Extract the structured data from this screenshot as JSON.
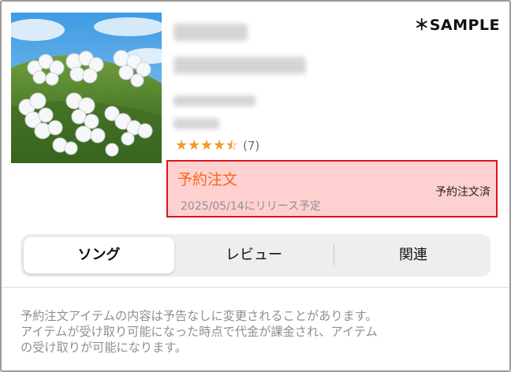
{
  "watermark": "＊SAMPLE",
  "rating": {
    "value": 4.5,
    "max": 5,
    "count_text": "(7)",
    "star_color": "#f09a2a"
  },
  "preorder": {
    "title": "予約注文",
    "release_text": "2025/05/14にリリース予定",
    "status": "予約注文済",
    "title_color": "#f26a1b",
    "box_color": "#ffd0d0",
    "border_color": "#e0141e"
  },
  "tabs": [
    {
      "label": "ソング",
      "selected": true
    },
    {
      "label": "レビュー",
      "selected": false
    },
    {
      "label": "関連",
      "selected": false
    }
  ],
  "disclaimer_lines": [
    "予約注文アイテムの内容は予告なしに変更されることがあります。",
    "アイテムが受け取り可能になった時点で代金が課金され、アイテム",
    "の受け取りが可能になります。"
  ]
}
